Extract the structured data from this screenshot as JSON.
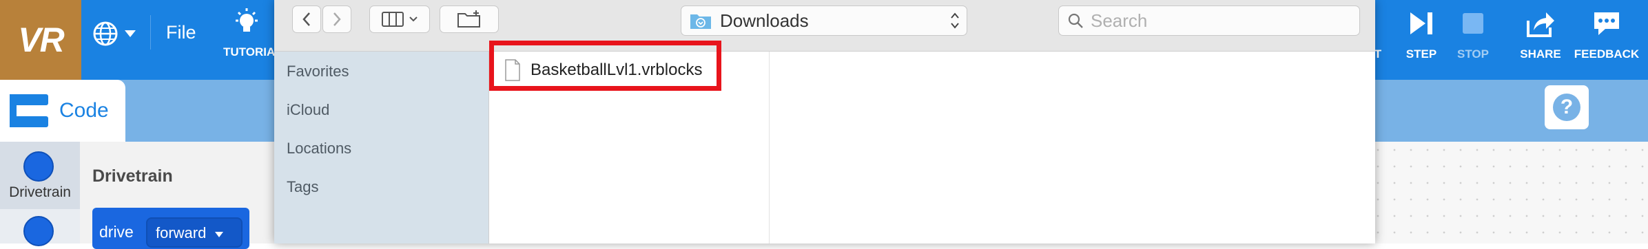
{
  "app": {
    "logo_text": "VR",
    "menu": {
      "file_label": "File",
      "tutorials_label": "TUTORIALS"
    },
    "right_toolbar": {
      "partial_label": "T",
      "step_label": "STEP",
      "stop_label": "STOP",
      "share_label": "SHARE",
      "feedback_label": "FEEDBACK"
    },
    "code_tab_label": "Code",
    "categories": [
      {
        "label": "Drivetrain"
      },
      {
        "label": ""
      }
    ],
    "palette": {
      "section_title": "Drivetrain",
      "block": {
        "command": "drive",
        "option": "forward"
      }
    },
    "colors": {
      "brand_blue": "#1a82e2",
      "logo_bg": "#b8813a",
      "block_blue": "#1a67e0"
    }
  },
  "dialog": {
    "location": {
      "value": "Downloads",
      "icon": "downloads-folder-icon"
    },
    "search": {
      "placeholder": "Search"
    },
    "sidebar": {
      "items": [
        {
          "label": "Favorites"
        },
        {
          "label": "iCloud"
        },
        {
          "label": "Locations"
        },
        {
          "label": "Tags"
        }
      ]
    },
    "files": [
      {
        "name": "BasketballLvl1.vrblocks",
        "icon": "document-icon",
        "highlighted": true
      }
    ],
    "highlight_color": "#e8141c"
  }
}
